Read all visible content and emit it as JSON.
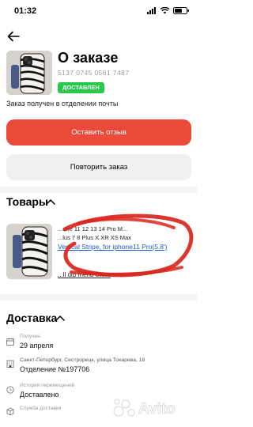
{
  "status_bar": {
    "time": "01:32"
  },
  "order": {
    "title": "О заказе",
    "number": "5137 0745 0561 7487",
    "status": "ДОСТАВЛЕН",
    "received_text": "Заказ получен в отделении почты"
  },
  "actions": {
    "review_label": "Оставить отзыв",
    "repeat_label": "Повторить заказ"
  },
  "products_section": {
    "title": "Товары",
    "item": {
      "line1": "...one 11 12 13 14 Pro M...",
      "line2": "...lus 7 8 Plus X XR XS Max",
      "link": "Vertical Stripe, for iphone11 Pro(5.8')",
      "store": "...ll old friend Store"
    }
  },
  "delivery_section": {
    "title": "Доставка",
    "received": {
      "label": "Получен",
      "value": "29 апреля"
    },
    "address": {
      "line1": "Санкт-Петербург, Сестрорецк, улица Токарева, 18",
      "line2": "Отделение №197706"
    },
    "history": {
      "label": "История перемещений",
      "value": "Доставлено"
    },
    "service": {
      "label": "Служба доставки"
    }
  },
  "watermark": {
    "text": "Avito"
  }
}
